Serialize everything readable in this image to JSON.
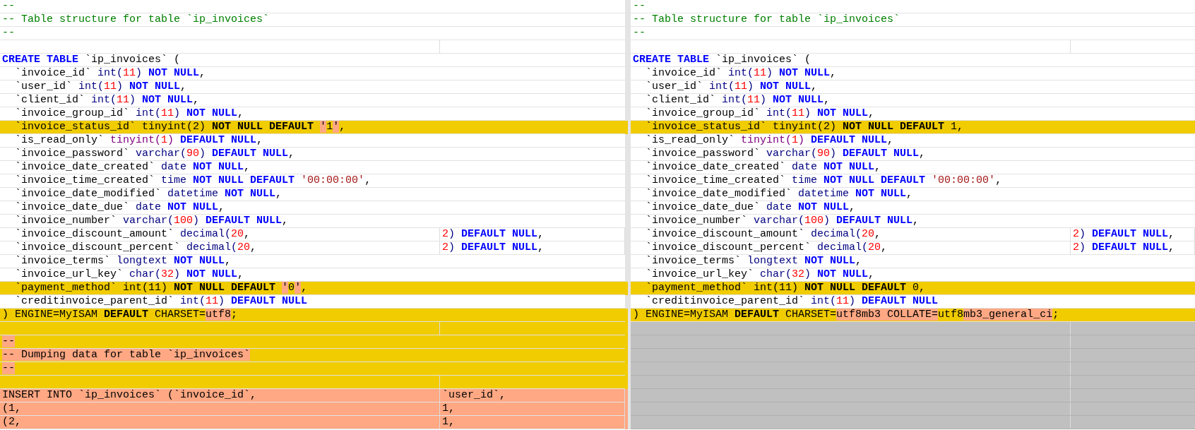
{
  "panes": [
    {
      "rows": [
        {
          "kind": "same",
          "cells": [
            [
              {
                "text": "--",
                "kind": "comment"
              }
            ]
          ]
        },
        {
          "kind": "same",
          "cells": [
            [
              {
                "text": "-- Table structure for table `ip_invoices`",
                "kind": "comment"
              }
            ]
          ]
        },
        {
          "kind": "same",
          "cells": [
            [
              {
                "text": "--",
                "kind": "comment"
              }
            ]
          ]
        },
        {
          "kind": "same",
          "cells": []
        },
        {
          "kind": "same",
          "cells": [
            [
              {
                "text": "CREATE TABLE",
                "kind": "kw"
              },
              {
                "text": " `ip_invoices` (",
                "kind": "plain"
              }
            ]
          ]
        },
        {
          "kind": "same",
          "cells": [
            [
              {
                "text": "  `invoice_id` ",
                "kind": "plain"
              },
              {
                "text": "int(",
                "kind": "type"
              },
              {
                "text": "11",
                "kind": "num"
              },
              {
                "text": ") ",
                "kind": "type"
              },
              {
                "text": "NOT NULL",
                "kind": "kw"
              },
              {
                "text": ",",
                "kind": "plain"
              }
            ]
          ]
        },
        {
          "kind": "same",
          "cells": [
            [
              {
                "text": "  `user_id` ",
                "kind": "plain"
              },
              {
                "text": "int(",
                "kind": "type"
              },
              {
                "text": "11",
                "kind": "num"
              },
              {
                "text": ") ",
                "kind": "type"
              },
              {
                "text": "NOT NULL",
                "kind": "kw"
              },
              {
                "text": ",",
                "kind": "plain"
              }
            ]
          ]
        },
        {
          "kind": "same",
          "cells": [
            [
              {
                "text": "  `client_id` ",
                "kind": "plain"
              },
              {
                "text": "int(",
                "kind": "type"
              },
              {
                "text": "11",
                "kind": "num"
              },
              {
                "text": ") ",
                "kind": "type"
              },
              {
                "text": "NOT NULL",
                "kind": "kw"
              },
              {
                "text": ",",
                "kind": "plain"
              }
            ]
          ]
        },
        {
          "kind": "same",
          "cells": [
            [
              {
                "text": "  `invoice_group_id` ",
                "kind": "plain"
              },
              {
                "text": "int(",
                "kind": "type"
              },
              {
                "text": "11",
                "kind": "num"
              },
              {
                "text": ") ",
                "kind": "type"
              },
              {
                "text": "NOT NULL",
                "kind": "kw"
              },
              {
                "text": ",",
                "kind": "plain"
              }
            ]
          ]
        },
        {
          "kind": "changed",
          "cells": [
            [
              {
                "text": "  `invoice_status_id` tinyint(2) ",
                "kind": "plain"
              },
              {
                "text": "NOT NULL DEFAULT",
                "kind": "kw"
              },
              {
                "text": " ",
                "kind": "plain"
              },
              {
                "text": "'",
                "kind": "diff"
              },
              {
                "text": "1",
                "kind": "plain"
              },
              {
                "text": "'",
                "kind": "diff"
              },
              {
                "text": ",",
                "kind": "plain"
              }
            ]
          ]
        },
        {
          "kind": "same",
          "cells": [
            [
              {
                "text": "  `is_read_only` ",
                "kind": "plain"
              },
              {
                "text": "tinyint(",
                "kind": "type2"
              },
              {
                "text": "1",
                "kind": "num"
              },
              {
                "text": ") ",
                "kind": "type2"
              },
              {
                "text": "DEFAULT NULL",
                "kind": "kw"
              },
              {
                "text": ",",
                "kind": "plain"
              }
            ]
          ]
        },
        {
          "kind": "same",
          "cells": [
            [
              {
                "text": "  `invoice_password` ",
                "kind": "plain"
              },
              {
                "text": "varchar(",
                "kind": "type"
              },
              {
                "text": "90",
                "kind": "num"
              },
              {
                "text": ") ",
                "kind": "type"
              },
              {
                "text": "DEFAULT NULL",
                "kind": "kw"
              },
              {
                "text": ",",
                "kind": "plain"
              }
            ]
          ]
        },
        {
          "kind": "same",
          "cells": [
            [
              {
                "text": "  `invoice_date_created` ",
                "kind": "plain"
              },
              {
                "text": "date ",
                "kind": "type"
              },
              {
                "text": "NOT NULL",
                "kind": "kw"
              },
              {
                "text": ",",
                "kind": "plain"
              }
            ]
          ]
        },
        {
          "kind": "same",
          "cells": [
            [
              {
                "text": "  `invoice_time_created` ",
                "kind": "plain"
              },
              {
                "text": "time ",
                "kind": "type"
              },
              {
                "text": "NOT NULL DEFAULT",
                "kind": "kw"
              },
              {
                "text": " ",
                "kind": "plain"
              },
              {
                "text": "'00:00:00'",
                "kind": "str"
              },
              {
                "text": ",",
                "kind": "plain"
              }
            ]
          ]
        },
        {
          "kind": "same",
          "cells": [
            [
              {
                "text": "  `invoice_date_modified` ",
                "kind": "plain"
              },
              {
                "text": "datetime ",
                "kind": "type"
              },
              {
                "text": "NOT NULL",
                "kind": "kw"
              },
              {
                "text": ",",
                "kind": "plain"
              }
            ]
          ]
        },
        {
          "kind": "same",
          "cells": [
            [
              {
                "text": "  `invoice_date_due` ",
                "kind": "plain"
              },
              {
                "text": "date ",
                "kind": "type"
              },
              {
                "text": "NOT NULL",
                "kind": "kw"
              },
              {
                "text": ",",
                "kind": "plain"
              }
            ]
          ]
        },
        {
          "kind": "same",
          "cells": [
            [
              {
                "text": "  `invoice_number` ",
                "kind": "plain"
              },
              {
                "text": "varchar(",
                "kind": "type"
              },
              {
                "text": "100",
                "kind": "num"
              },
              {
                "text": ") ",
                "kind": "type"
              },
              {
                "text": "DEFAULT NULL",
                "kind": "kw"
              },
              {
                "text": ",",
                "kind": "plain"
              }
            ]
          ]
        },
        {
          "kind": "same",
          "cells": [
            [
              {
                "text": "  `invoice_discount_amount` ",
                "kind": "plain"
              },
              {
                "text": "decimal(",
                "kind": "type"
              },
              {
                "text": "20",
                "kind": "num"
              },
              {
                "text": ",",
                "kind": "plain"
              }
            ],
            [
              {
                "text": "2",
                "kind": "num"
              },
              {
                "text": ") ",
                "kind": "type"
              },
              {
                "text": "DEFAULT NULL",
                "kind": "kw"
              },
              {
                "text": ",",
                "kind": "plain"
              }
            ]
          ]
        },
        {
          "kind": "same",
          "cells": [
            [
              {
                "text": "  `invoice_discount_percent` ",
                "kind": "plain"
              },
              {
                "text": "decimal(",
                "kind": "type"
              },
              {
                "text": "20",
                "kind": "num"
              },
              {
                "text": ",",
                "kind": "plain"
              }
            ],
            [
              {
                "text": "2",
                "kind": "num"
              },
              {
                "text": ") ",
                "kind": "type"
              },
              {
                "text": "DEFAULT NULL",
                "kind": "kw"
              },
              {
                "text": ",",
                "kind": "plain"
              }
            ]
          ]
        },
        {
          "kind": "same",
          "cells": [
            [
              {
                "text": "  `invoice_terms` ",
                "kind": "plain"
              },
              {
                "text": "longtext ",
                "kind": "type"
              },
              {
                "text": "NOT NULL",
                "kind": "kw"
              },
              {
                "text": ",",
                "kind": "plain"
              }
            ]
          ]
        },
        {
          "kind": "same",
          "cells": [
            [
              {
                "text": "  `invoice_url_key` ",
                "kind": "plain"
              },
              {
                "text": "char(",
                "kind": "type"
              },
              {
                "text": "32",
                "kind": "num"
              },
              {
                "text": ") ",
                "kind": "type"
              },
              {
                "text": "NOT NULL",
                "kind": "kw"
              },
              {
                "text": ",",
                "kind": "plain"
              }
            ]
          ]
        },
        {
          "kind": "changed",
          "cells": [
            [
              {
                "text": "  `payment_method` int(11) ",
                "kind": "plain"
              },
              {
                "text": "NOT NULL DEFAULT",
                "kind": "kw"
              },
              {
                "text": " ",
                "kind": "plain"
              },
              {
                "text": "'",
                "kind": "diff"
              },
              {
                "text": "0",
                "kind": "plain"
              },
              {
                "text": "'",
                "kind": "diff"
              },
              {
                "text": ",",
                "kind": "plain"
              }
            ]
          ]
        },
        {
          "kind": "same",
          "cells": [
            [
              {
                "text": "  `creditinvoice_parent_id` ",
                "kind": "plain"
              },
              {
                "text": "int(",
                "kind": "type"
              },
              {
                "text": "11",
                "kind": "num"
              },
              {
                "text": ") ",
                "kind": "type"
              },
              {
                "text": "DEFAULT NULL",
                "kind": "kw"
              }
            ]
          ]
        },
        {
          "kind": "changed",
          "cells": [
            [
              {
                "text": ") ENGINE=MyISAM ",
                "kind": "plain"
              },
              {
                "text": "DEFAULT",
                "kind": "kw"
              },
              {
                "text": " CHARSET=",
                "kind": "plain"
              },
              {
                "text": "utf8",
                "kind": "diff"
              },
              {
                "text": ";",
                "kind": "plain"
              }
            ]
          ]
        },
        {
          "kind": "changed",
          "cells": []
        },
        {
          "kind": "changed",
          "cells": [
            [
              {
                "text": "--",
                "kind": "diff"
              }
            ]
          ]
        },
        {
          "kind": "changed",
          "cells": [
            [
              {
                "text": "-- Dumping data for table `ip_invoices`",
                "kind": "diff"
              }
            ]
          ]
        },
        {
          "kind": "changed",
          "cells": [
            [
              {
                "text": "--",
                "kind": "diff"
              }
            ]
          ]
        },
        {
          "kind": "changed",
          "cells": []
        },
        {
          "kind": "removed",
          "cells": [
            [
              {
                "text": "INSERT INTO `ip_invoices` (`invoice_id`,",
                "kind": "plain"
              }
            ],
            [
              {
                "text": "`user_id`,",
                "kind": "plain"
              }
            ]
          ]
        },
        {
          "kind": "removed",
          "cells": [
            [
              {
                "text": "(1,",
                "kind": "plain"
              }
            ],
            [
              {
                "text": "1,",
                "kind": "plain"
              }
            ]
          ]
        },
        {
          "kind": "removed",
          "cells": [
            [
              {
                "text": "(2,",
                "kind": "plain"
              }
            ],
            [
              {
                "text": "1,",
                "kind": "plain"
              }
            ]
          ]
        }
      ]
    },
    {
      "rows": [
        {
          "kind": "same",
          "cells": [
            [
              {
                "text": "--",
                "kind": "comment"
              }
            ]
          ]
        },
        {
          "kind": "same",
          "cells": [
            [
              {
                "text": "-- Table structure for table `ip_invoices`",
                "kind": "comment"
              }
            ]
          ]
        },
        {
          "kind": "same",
          "cells": [
            [
              {
                "text": "--",
                "kind": "comment"
              }
            ]
          ]
        },
        {
          "kind": "same",
          "cells": []
        },
        {
          "kind": "same",
          "cells": [
            [
              {
                "text": "CREATE TABLE",
                "kind": "kw"
              },
              {
                "text": " `ip_invoices` (",
                "kind": "plain"
              }
            ]
          ]
        },
        {
          "kind": "same",
          "cells": [
            [
              {
                "text": "  `invoice_id` ",
                "kind": "plain"
              },
              {
                "text": "int(",
                "kind": "type"
              },
              {
                "text": "11",
                "kind": "num"
              },
              {
                "text": ") ",
                "kind": "type"
              },
              {
                "text": "NOT NULL",
                "kind": "kw"
              },
              {
                "text": ",",
                "kind": "plain"
              }
            ]
          ]
        },
        {
          "kind": "same",
          "cells": [
            [
              {
                "text": "  `user_id` ",
                "kind": "plain"
              },
              {
                "text": "int(",
                "kind": "type"
              },
              {
                "text": "11",
                "kind": "num"
              },
              {
                "text": ") ",
                "kind": "type"
              },
              {
                "text": "NOT NULL",
                "kind": "kw"
              },
              {
                "text": ",",
                "kind": "plain"
              }
            ]
          ]
        },
        {
          "kind": "same",
          "cells": [
            [
              {
                "text": "  `client_id` ",
                "kind": "plain"
              },
              {
                "text": "int(",
                "kind": "type"
              },
              {
                "text": "11",
                "kind": "num"
              },
              {
                "text": ") ",
                "kind": "type"
              },
              {
                "text": "NOT NULL",
                "kind": "kw"
              },
              {
                "text": ",",
                "kind": "plain"
              }
            ]
          ]
        },
        {
          "kind": "same",
          "cells": [
            [
              {
                "text": "  `invoice_group_id` ",
                "kind": "plain"
              },
              {
                "text": "int(",
                "kind": "type"
              },
              {
                "text": "11",
                "kind": "num"
              },
              {
                "text": ") ",
                "kind": "type"
              },
              {
                "text": "NOT NULL",
                "kind": "kw"
              },
              {
                "text": ",",
                "kind": "plain"
              }
            ]
          ]
        },
        {
          "kind": "changed",
          "cells": [
            [
              {
                "text": "  `invoice_status_id` tinyint(2) ",
                "kind": "plain"
              },
              {
                "text": "NOT NULL DEFAULT",
                "kind": "kw"
              },
              {
                "text": " 1,",
                "kind": "plain"
              }
            ]
          ]
        },
        {
          "kind": "same",
          "cells": [
            [
              {
                "text": "  `is_read_only` ",
                "kind": "plain"
              },
              {
                "text": "tinyint(",
                "kind": "type2"
              },
              {
                "text": "1",
                "kind": "num"
              },
              {
                "text": ") ",
                "kind": "type2"
              },
              {
                "text": "DEFAULT NULL",
                "kind": "kw"
              },
              {
                "text": ",",
                "kind": "plain"
              }
            ]
          ]
        },
        {
          "kind": "same",
          "cells": [
            [
              {
                "text": "  `invoice_password` ",
                "kind": "plain"
              },
              {
                "text": "varchar(",
                "kind": "type"
              },
              {
                "text": "90",
                "kind": "num"
              },
              {
                "text": ") ",
                "kind": "type"
              },
              {
                "text": "DEFAULT NULL",
                "kind": "kw"
              },
              {
                "text": ",",
                "kind": "plain"
              }
            ]
          ]
        },
        {
          "kind": "same",
          "cells": [
            [
              {
                "text": "  `invoice_date_created` ",
                "kind": "plain"
              },
              {
                "text": "date ",
                "kind": "type"
              },
              {
                "text": "NOT NULL",
                "kind": "kw"
              },
              {
                "text": ",",
                "kind": "plain"
              }
            ]
          ]
        },
        {
          "kind": "same",
          "cells": [
            [
              {
                "text": "  `invoice_time_created` ",
                "kind": "plain"
              },
              {
                "text": "time ",
                "kind": "type"
              },
              {
                "text": "NOT NULL DEFAULT",
                "kind": "kw"
              },
              {
                "text": " ",
                "kind": "plain"
              },
              {
                "text": "'00:00:00'",
                "kind": "str"
              },
              {
                "text": ",",
                "kind": "plain"
              }
            ]
          ]
        },
        {
          "kind": "same",
          "cells": [
            [
              {
                "text": "  `invoice_date_modified` ",
                "kind": "plain"
              },
              {
                "text": "datetime ",
                "kind": "type"
              },
              {
                "text": "NOT NULL",
                "kind": "kw"
              },
              {
                "text": ",",
                "kind": "plain"
              }
            ]
          ]
        },
        {
          "kind": "same",
          "cells": [
            [
              {
                "text": "  `invoice_date_due` ",
                "kind": "plain"
              },
              {
                "text": "date ",
                "kind": "type"
              },
              {
                "text": "NOT NULL",
                "kind": "kw"
              },
              {
                "text": ",",
                "kind": "plain"
              }
            ]
          ]
        },
        {
          "kind": "same",
          "cells": [
            [
              {
                "text": "  `invoice_number` ",
                "kind": "plain"
              },
              {
                "text": "varchar(",
                "kind": "type"
              },
              {
                "text": "100",
                "kind": "num"
              },
              {
                "text": ") ",
                "kind": "type"
              },
              {
                "text": "DEFAULT NULL",
                "kind": "kw"
              },
              {
                "text": ",",
                "kind": "plain"
              }
            ]
          ]
        },
        {
          "kind": "same",
          "cells": [
            [
              {
                "text": "  `invoice_discount_amount` ",
                "kind": "plain"
              },
              {
                "text": "decimal(",
                "kind": "type"
              },
              {
                "text": "20",
                "kind": "num"
              },
              {
                "text": ",",
                "kind": "plain"
              }
            ],
            [
              {
                "text": "2",
                "kind": "num"
              },
              {
                "text": ") ",
                "kind": "type"
              },
              {
                "text": "DEFAULT NULL",
                "kind": "kw"
              },
              {
                "text": ",",
                "kind": "plain"
              }
            ]
          ]
        },
        {
          "kind": "same",
          "cells": [
            [
              {
                "text": "  `invoice_discount_percent` ",
                "kind": "plain"
              },
              {
                "text": "decimal(",
                "kind": "type"
              },
              {
                "text": "20",
                "kind": "num"
              },
              {
                "text": ",",
                "kind": "plain"
              }
            ],
            [
              {
                "text": "2",
                "kind": "num"
              },
              {
                "text": ") ",
                "kind": "type"
              },
              {
                "text": "DEFAULT NULL",
                "kind": "kw"
              },
              {
                "text": ",",
                "kind": "plain"
              }
            ]
          ]
        },
        {
          "kind": "same",
          "cells": [
            [
              {
                "text": "  `invoice_terms` ",
                "kind": "plain"
              },
              {
                "text": "longtext ",
                "kind": "type"
              },
              {
                "text": "NOT NULL",
                "kind": "kw"
              },
              {
                "text": ",",
                "kind": "plain"
              }
            ]
          ]
        },
        {
          "kind": "same",
          "cells": [
            [
              {
                "text": "  `invoice_url_key` ",
                "kind": "plain"
              },
              {
                "text": "char(",
                "kind": "type"
              },
              {
                "text": "32",
                "kind": "num"
              },
              {
                "text": ") ",
                "kind": "type"
              },
              {
                "text": "NOT NULL",
                "kind": "kw"
              },
              {
                "text": ",",
                "kind": "plain"
              }
            ]
          ]
        },
        {
          "kind": "changed",
          "cells": [
            [
              {
                "text": "  `payment_method` int(11) ",
                "kind": "plain"
              },
              {
                "text": "NOT NULL DEFAULT",
                "kind": "kw"
              },
              {
                "text": " 0,",
                "kind": "plain"
              }
            ]
          ]
        },
        {
          "kind": "same",
          "cells": [
            [
              {
                "text": "  `creditinvoice_parent_id` ",
                "kind": "plain"
              },
              {
                "text": "int(",
                "kind": "type"
              },
              {
                "text": "11",
                "kind": "num"
              },
              {
                "text": ") ",
                "kind": "type"
              },
              {
                "text": "DEFAULT NULL",
                "kind": "kw"
              }
            ]
          ]
        },
        {
          "kind": "changed",
          "cells": [
            [
              {
                "text": ") ENGINE=MyISAM ",
                "kind": "plain"
              },
              {
                "text": "DEFAULT",
                "kind": "kw"
              },
              {
                "text": " CHARSET=",
                "kind": "plain"
              },
              {
                "text": "utf8mb3 COLLATE=",
                "kind": "diff"
              },
              {
                "text": "utf8",
                "kind": "plain"
              },
              {
                "text": "mb3_general_ci",
                "kind": "diff"
              },
              {
                "text": ";",
                "kind": "plain"
              }
            ]
          ]
        },
        {
          "kind": "missing",
          "cells": []
        },
        {
          "kind": "missing",
          "cells": []
        },
        {
          "kind": "missing",
          "cells": []
        },
        {
          "kind": "missing",
          "cells": []
        },
        {
          "kind": "missing",
          "cells": []
        },
        {
          "kind": "missing",
          "cells": []
        },
        {
          "kind": "missing",
          "cells": []
        },
        {
          "kind": "missing",
          "cells": []
        }
      ]
    }
  ]
}
